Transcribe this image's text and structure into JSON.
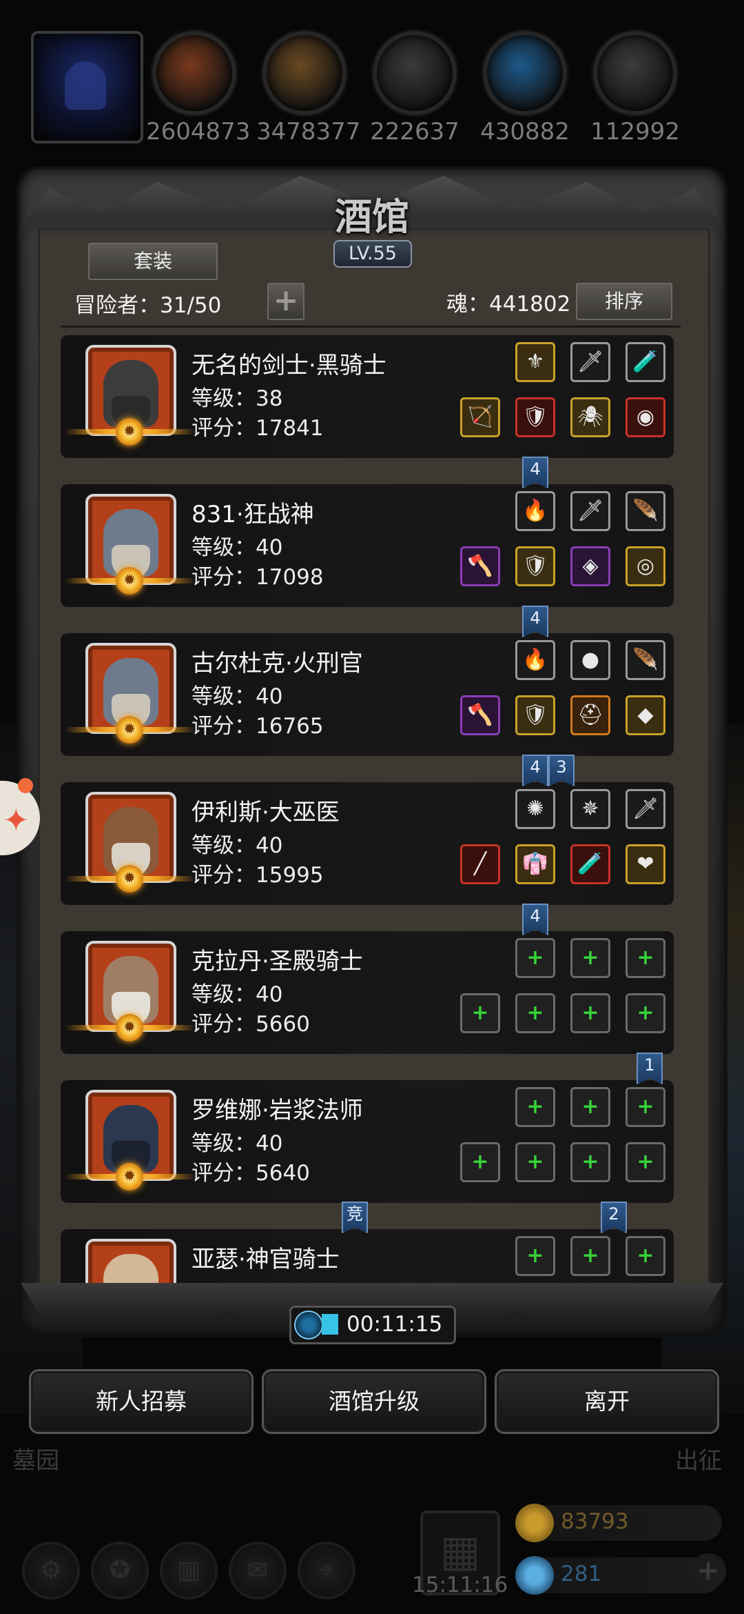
{
  "resources": [
    {
      "icon": "meat-icon",
      "value": "2604873",
      "color": "#7a3a1c"
    },
    {
      "icon": "wood-icon",
      "value": "3478377",
      "color": "#6b4a22"
    },
    {
      "icon": "stone-icon",
      "value": "222637",
      "color": "#3a3a3a"
    },
    {
      "icon": "crystal-icon",
      "value": "430882",
      "color": "#1d5a8c"
    },
    {
      "icon": "iron-icon",
      "value": "112992",
      "color": "#3c3c3c"
    }
  ],
  "panel": {
    "title": "酒馆",
    "level": "LV.55",
    "suit_button": "套装",
    "adventurers": "冒险者：31/50",
    "soul": "魂：441802",
    "sort_button": "排序"
  },
  "heroes": [
    {
      "name": "无名的剑士·黑骑士",
      "level": "等级：38",
      "score": "评分：17841",
      "portrait": "black-knight",
      "face_color": "#3c3c3c",
      "beard_color": "#2a2a2a",
      "top_slots": [
        {
          "icon": "⚜",
          "tier": "gold"
        },
        {
          "icon": "🗡",
          "tier": ""
        },
        {
          "icon": "🧪",
          "tier": ""
        }
      ],
      "bottom_slots": [
        {
          "icon": "🏹",
          "tier": "gold"
        },
        {
          "icon": "🛡",
          "tier": "red"
        },
        {
          "icon": "🕷",
          "tier": "gold"
        },
        {
          "icon": "◉",
          "tier": "red"
        }
      ]
    },
    {
      "name": "831·狂战神",
      "level": "等级：40",
      "score": "评分：17098",
      "portrait": "berserker",
      "face_color": "#6f7a8c",
      "beard_color": "#c9c3b8",
      "top_slots": [
        {
          "icon": "🔥",
          "tier": ""
        },
        {
          "icon": "🗡",
          "tier": ""
        },
        {
          "icon": "🪶",
          "tier": ""
        }
      ],
      "bottom_slots": [
        {
          "icon": "🪓",
          "tier": "purple"
        },
        {
          "icon": "🛡",
          "tier": "gold"
        },
        {
          "icon": "◈",
          "tier": "purple"
        },
        {
          "icon": "◎",
          "tier": "gold"
        }
      ]
    },
    {
      "name": "古尔杜克·火刑官",
      "level": "等级：40",
      "score": "评分：16765",
      "portrait": "executioner",
      "face_color": "#6f7a8c",
      "beard_color": "#c9c3b8",
      "top_slots": [
        {
          "icon": "🔥",
          "tier": ""
        },
        {
          "icon": "●",
          "tier": ""
        },
        {
          "icon": "🪶",
          "tier": ""
        }
      ],
      "bottom_slots": [
        {
          "icon": "🪓",
          "tier": "purple"
        },
        {
          "icon": "🛡",
          "tier": "gold"
        },
        {
          "icon": "⛑",
          "tier": "orange"
        },
        {
          "icon": "◆",
          "tier": "gold"
        }
      ]
    },
    {
      "name": "伊利斯·大巫医",
      "level": "等级：40",
      "score": "评分：15995",
      "portrait": "witch-doctor",
      "face_color": "#8a5a3a",
      "beard_color": "#d8d2c6",
      "top_slots": [
        {
          "icon": "✺",
          "tier": ""
        },
        {
          "icon": "✵",
          "tier": ""
        },
        {
          "icon": "🗡",
          "tier": ""
        }
      ],
      "bottom_slots": [
        {
          "icon": "╱",
          "tier": "red"
        },
        {
          "icon": "👘",
          "tier": "gold"
        },
        {
          "icon": "🧪",
          "tier": "red"
        },
        {
          "icon": "❤",
          "tier": "gold"
        }
      ]
    },
    {
      "name": "克拉丹·圣殿骑士",
      "level": "等级：40",
      "score": "评分：5660",
      "portrait": "templar",
      "face_color": "#a07e66",
      "beard_color": "#e4e0d8",
      "top_slots": [
        {
          "icon": "+",
          "tier": "empty"
        },
        {
          "icon": "+",
          "tier": "empty"
        },
        {
          "icon": "+",
          "tier": "empty"
        }
      ],
      "bottom_slots": [
        {
          "icon": "+",
          "tier": "empty"
        },
        {
          "icon": "+",
          "tier": "empty"
        },
        {
          "icon": "+",
          "tier": "empty"
        },
        {
          "icon": "+",
          "tier": "empty"
        }
      ]
    },
    {
      "name": "罗维娜·岩浆法师",
      "level": "等级：40",
      "score": "评分：5640",
      "portrait": "magma-mage",
      "face_color": "#2c3850",
      "beard_color": "#1c2230",
      "top_slots": [
        {
          "icon": "+",
          "tier": "empty"
        },
        {
          "icon": "+",
          "tier": "empty"
        },
        {
          "icon": "+",
          "tier": "empty"
        }
      ],
      "bottom_slots": [
        {
          "icon": "+",
          "tier": "empty"
        },
        {
          "icon": "+",
          "tier": "empty"
        },
        {
          "icon": "+",
          "tier": "empty"
        },
        {
          "icon": "+",
          "tier": "empty"
        }
      ]
    },
    {
      "name": "亚瑟·神官骑士",
      "level": "",
      "score": "",
      "portrait": "paladin",
      "face_color": "#d4b898",
      "beard_color": "#e6e2d8",
      "top_slots": [
        {
          "icon": "+",
          "tier": "empty"
        },
        {
          "icon": "+",
          "tier": "empty"
        },
        {
          "icon": "+",
          "tier": "empty"
        }
      ],
      "bottom_slots": []
    }
  ],
  "tabs": [
    {
      "label": "4"
    },
    {
      "label": "4"
    },
    {
      "label": "4"
    },
    {
      "label": "3"
    },
    {
      "label": "4"
    },
    {
      "label": "1"
    },
    {
      "label": "竞"
    },
    {
      "label": "2"
    }
  ],
  "timer": "00:11:15",
  "buttons": {
    "recruit": "新人招募",
    "upgrade": "酒馆升级",
    "leave": "离开"
  },
  "side_labels": {
    "left": "墓园",
    "right": "出征"
  },
  "bottom": {
    "clock": "15:11:16",
    "gold": "83793",
    "gems": "281",
    "gold_color": "#7a5a1a",
    "gem_color": "#1d4a70"
  },
  "nav_icons": [
    "gear-icon",
    "star-icon",
    "book-icon",
    "mail-icon",
    "map-icon"
  ]
}
